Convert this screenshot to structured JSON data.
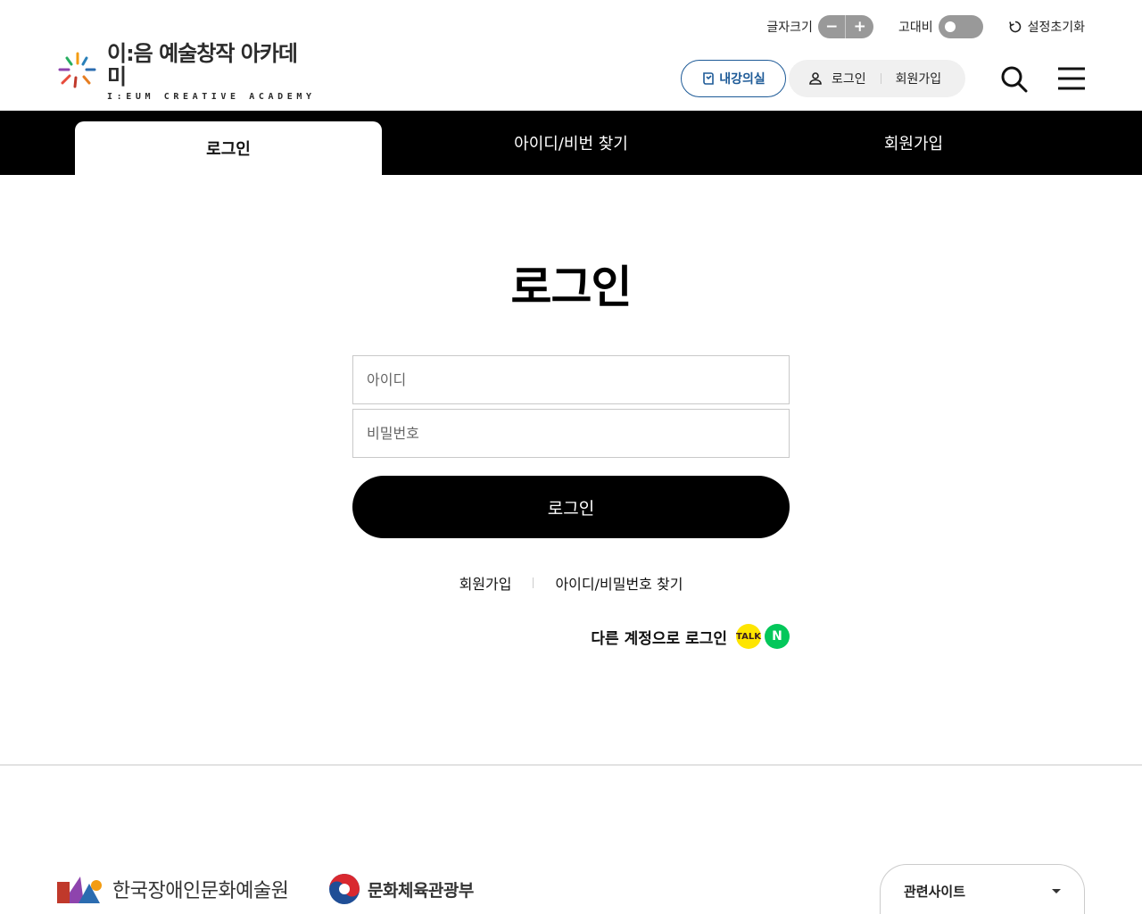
{
  "util": {
    "font_size_label": "글자크기",
    "font_minus": "−",
    "font_plus": "+",
    "contrast_label": "고대비",
    "reset_label": "설정초기화"
  },
  "header": {
    "logo_ko": "이:음 예술창작 아카데미",
    "logo_en": "I:EUM CREATIVE ACADEMY",
    "classroom_label": "내강의실",
    "login_label": "로그인",
    "signup_label": "회원가입"
  },
  "tabs": [
    {
      "label": "로그인",
      "active": true
    },
    {
      "label": "아이디/비번 찾기",
      "active": false
    },
    {
      "label": "회원가입",
      "active": false
    }
  ],
  "main": {
    "title": "로그인",
    "id_placeholder": "아이디",
    "pw_placeholder": "비밀번호",
    "submit_label": "로그인",
    "link_signup": "회원가입",
    "link_find": "아이디/비밀번호 찾기",
    "sns_label": "다른 계정으로 로그인",
    "kakao_text": "TALK",
    "naver_text": "N"
  },
  "footer": {
    "org1": "한국장애인문화예술원",
    "org2": "문화체육관광부",
    "related_label": "관련사이트"
  },
  "colors": {
    "accent_blue": "#1d5a97",
    "tabbar_bg": "#000000",
    "kakao": "#fee500",
    "naver": "#03c75a"
  }
}
